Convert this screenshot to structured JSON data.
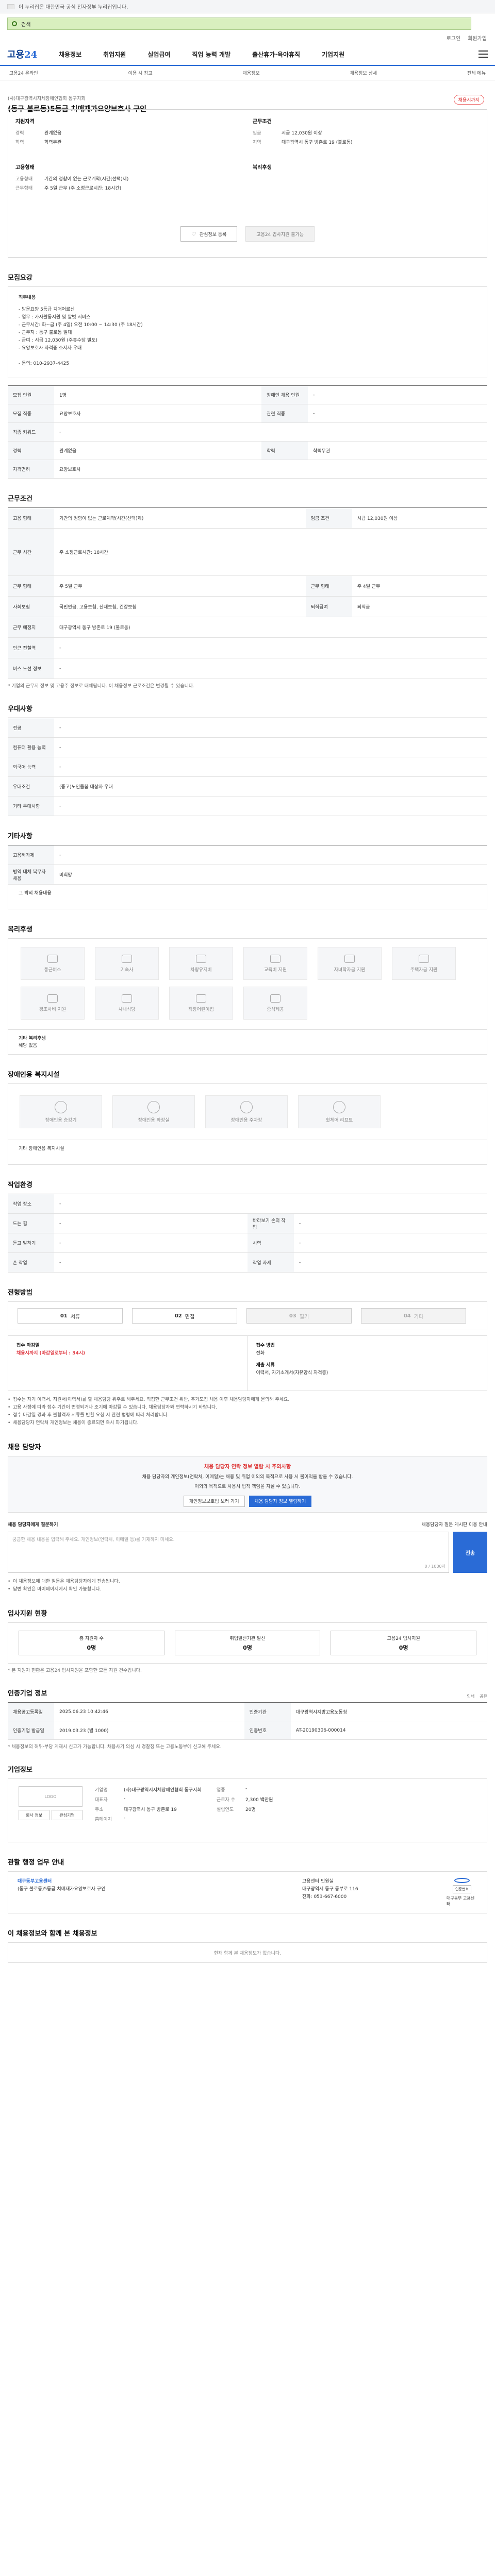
{
  "gov_banner": {
    "text": "이 누리집은 대한민국 공식 전자정부 누리집입니다."
  },
  "search": {
    "query": "검색"
  },
  "top_links": [
    "로그인",
    "회원가입"
  ],
  "logo": {
    "main": "고용",
    "accent": "24"
  },
  "gnb": [
    "채용정보",
    "취업지원",
    "실업급여",
    "직업 능력 개발",
    "출산휴가·육아휴직",
    "기업지원"
  ],
  "sub_gnb": [
    "고용24 온라인",
    "이용 시 참고",
    "채용정보",
    "채용정보 상세",
    "전체 메뉴"
  ],
  "job": {
    "company_line": "(사)대구광역시지체장애인협회 동구지회",
    "title": "(동구 불로동)5등급 치매재가요양보호사 구인",
    "badge": "채용시까지"
  },
  "summary": {
    "qual_title": "지원자격",
    "qual": [
      {
        "k": "경력",
        "v": "관계없음"
      },
      {
        "k": "학력",
        "v": "학력무관"
      }
    ],
    "cond_title": "근무조건",
    "cond": [
      {
        "k": "임금",
        "v": "시급 12,030원 이상"
      },
      {
        "k": "지역",
        "v": "대구광역시 동구 방촌로 19 (불로동)"
      }
    ],
    "type_title": "고용형태",
    "type": [
      {
        "k": "고용형태",
        "v": "기간의 정함이 없는 근로계약(시간(선택)제)"
      },
      {
        "k": "근무형태",
        "v": "주 5일 근무 (주 소정근로시간: 18시간)"
      }
    ],
    "welfare_title": "복리후생",
    "btn_scrap": "관심정보 등록",
    "btn_apply": "고용24 입사지원 불가능"
  },
  "sections": {
    "recruit": "모집요강",
    "work": "근무조건",
    "pref": "우대사항",
    "etc": "기타사항",
    "welfare": "복리후생",
    "disab": "장애인용 복지시설",
    "env": "작업환경",
    "process": "전형방법",
    "contact": "채용 담당자",
    "stats": "입사지원 현황",
    "info": "인증기업 정보",
    "company": "기업정보",
    "agency": "관할 행정 업무 안내",
    "recommend": "이 채용정보와 함께 본 채용정보"
  },
  "job_desc": {
    "title": "직무내용",
    "lines": [
      "- 방문요양 5등급 치매어르신",
      "- 업무 : 가사활동지원 및 말벗 서비스",
      "- 근무시간: 화~금 (주 4일) 오전 10:00 ~ 14:30 (주 18시간)",
      "- 근무지 : 동구 불로동 일대",
      "- 급여 : 시급 12,030원 (주휴수당 별도)",
      "- 요양보호사 자격증 소지자 우대",
      "",
      "- 문의: 010-2937-4425"
    ]
  },
  "recruit_table": [
    {
      "k1": "모집 인원",
      "v1": "1명",
      "k2": "장애인 채용 인원",
      "v2": "-"
    },
    {
      "k1": "모집 직종",
      "v1": "요양보호사",
      "k2": "관련 직종",
      "v2": "-"
    },
    {
      "k1": "직종 키워드",
      "v1": "-",
      "k2": "",
      "v2": ""
    },
    {
      "k1": "경력",
      "v1": "관계없음",
      "k2": "학력",
      "v2": "학력무관"
    },
    {
      "k1": "자격면허",
      "v1": "요양보호사",
      "k2": "",
      "v2": ""
    }
  ],
  "work_table": [
    {
      "k1": "고용 형태",
      "v1": "기간의 정함이 없는 근로계약(시간(선택)제)",
      "k2": "임금 조건",
      "v2": "시급 12,030원 이상"
    },
    {
      "k1": "근무 시간",
      "v1": "주 소정근로시간: 18시간",
      "k2": "",
      "v2": ""
    },
    {
      "k1": "근무 형태",
      "v1": "주 5일 근무",
      "k2": "근무 형태",
      "v2": "주 4일 근무"
    },
    {
      "k1": "사회보험",
      "v1": "국민연금, 고용보험, 산재보험, 건강보험",
      "k2": "퇴직급여",
      "v2": "퇴직금"
    },
    {
      "k1": "근무 예정지",
      "v1": "대구광역시 동구 방촌로 19 (불로동)",
      "k2": "",
      "v2": ""
    },
    {
      "k1": "인근 전철역",
      "v1": "-",
      "k2": "",
      "v2": ""
    },
    {
      "k1": "버스 노선 정보",
      "v1": "-",
      "k2": "",
      "v2": ""
    }
  ],
  "work_note": "* 기업의 근무지 정보 및 고용주 정보로 대체됩니다. 이 채용정보 근로조건은 변경될 수 있습니다.",
  "pref_table": [
    {
      "k": "전공",
      "v": "-"
    },
    {
      "k": "컴퓨터 활용 능력",
      "v": "-"
    },
    {
      "k": "외국어 능력",
      "v": "-"
    },
    {
      "k": "우대조건",
      "v": "(중고)노인돌봄 대상자 우대"
    },
    {
      "k": "기타 우대사항",
      "v": "-"
    }
  ],
  "etc_table": [
    {
      "k": "고용허가제",
      "v": "-"
    },
    {
      "k": "병역 대체 복무자 채용",
      "v": "비희망"
    }
  ],
  "etc_free": "그 밖의 채용내용",
  "welfare_items": [
    "통근버스",
    "기숙사",
    "차량유지비",
    "교육비 지원",
    "자녀학자금 지원",
    "주택자금 지원",
    "경조사비 지원",
    "사내식당",
    "직장어린이집",
    "중식제공"
  ],
  "welfare_free_label": "기타 복리후생",
  "welfare_free_value": "해당 없음",
  "disab_items": [
    "장애인용 승강기",
    "장애인용 화장실",
    "장애인용 주차장",
    "휠체어 리프트",
    "경사로"
  ],
  "disab_free": "기타 장애인용 복지시설",
  "env_table": [
    {
      "k1": "작업 장소",
      "v1": "-",
      "k2": "",
      "v2": ""
    },
    {
      "k1": "드는 힘",
      "v1": "-",
      "k2": "바라보기 손의 작업",
      "v2": "-"
    },
    {
      "k1": "듣고 말하기",
      "v1": "-",
      "k2": "시력",
      "v2": "-"
    },
    {
      "k1": "손 작업",
      "v1": "-",
      "k2": "작업 자세",
      "v2": "-"
    }
  ],
  "process_steps": [
    {
      "n": "01",
      "label": "서류",
      "on": true
    },
    {
      "n": "02",
      "label": "면접",
      "on": true
    },
    {
      "n": "03",
      "label": "필기",
      "on": false
    },
    {
      "n": "04",
      "label": "기타",
      "on": false
    }
  ],
  "apply": {
    "period_label": "접수 마감일",
    "period_value": "채용시까지 (마감일로부터 : 34시)",
    "method_label": "접수 방법",
    "method_value": "전화",
    "docs_label": "제출 서류",
    "docs_value": "이력서, 자기소개서(자유양식 자격증)"
  },
  "apply_bullets": [
    "접수는 자기 이력서, 지원서(이력서)를 할 채용담당 위주로 해주세요. 직접한 근무조건 위반, 추가모집 채용 이후 채용담당자에게 문의해 주세요.",
    "고용 사정에 따라 접수 기간이 변경되거나 조기에 마감될 수 있습니다. 채용담당자와 연락하시기 바랍니다.",
    "접수 마감일 경과 후 불합격자 서류를 반환 요청 시 관련 법령에 따라 처리합니다.",
    "채용담당자 연락처 개인정보는 채용이 종료되면 즉시 파기됩니다."
  ],
  "contact": {
    "warn": "채용 담당자 연락 정보 열람 시 주의사항",
    "line1": "채용 담당자의 개인정보(연락처, 이메일)는 채용 및 취업 이외의 목적으로 사용 시 불이익을 받을 수 있습니다.",
    "line2": "이외의 목적으로 사용시 법적 책임을 지실 수 있습니다.",
    "btn1": "개인정보보호법 보러 가기",
    "btn2": "채용 담당자 정보 열람하기"
  },
  "question": {
    "title": "채용 담당자에게 질문하기",
    "guide": "채용담당자 질문 게시판 이용 안내",
    "placeholder": "궁금한 채용 내용을 입력해 주세요. 개인정보(연락처, 이메일 등)를 기재하지 마세요.",
    "count": "0 / 1000자",
    "btn": "전송",
    "notes": [
      "이 채용정보에 대한 질문은 채용담당자에게 전송됩니다.",
      "답변 확인은 마이페이지에서 확인 가능합니다."
    ]
  },
  "stats": [
    {
      "label": "총 지원자 수",
      "value": "0명"
    },
    {
      "label": "취업알선기관 알선",
      "value": "0명"
    },
    {
      "label": "고용24 입사지원",
      "value": "0명"
    }
  ],
  "stats_note": "* 본 지원자 현황은 고용24 입사지원을 포함한 모든 지원 건수입니다.",
  "info_tools": [
    "인쇄",
    "공유"
  ],
  "info_table": [
    {
      "k1": "채용공고등록일",
      "v1": "2025.06.23 10:42:46",
      "k2": "인증기관",
      "v2": "대구광역시지방고용노동청"
    },
    {
      "k1": "인증기업 발급일",
      "v1": "2019.03.23 (별 1000)",
      "k2": "인증번호",
      "v2": "AT-20190306-000014"
    }
  ],
  "info_note": "* 채용정보의 허위·부당 게재시 신고가 가능합니다. 채용사기 의심 시 경찰청 또는 고용노동부에 신고해 주세요.",
  "company": {
    "logo_text": "LOGO",
    "btn1": "회사 정보",
    "btn2": "관심기업",
    "rows": [
      {
        "k1": "기업명",
        "v1": "(사)대구광역시지체장애인협회 동구지회",
        "k2": "업종",
        "v2": "-"
      },
      {
        "k1": "대표자",
        "v1": "-",
        "k2": "근로자 수",
        "v2": "2,300 백만원"
      },
      {
        "k1": "주소",
        "v1": "대구광역시 동구 방촌로 19",
        "k2": "설립연도",
        "v2": "20명"
      },
      {
        "k1": "홈페이지",
        "v1": "-",
        "k2": "",
        "v2": ""
      }
    ]
  },
  "agency": {
    "name": "대구동부고용센터",
    "job_line": "(동구 불로동)5등급 치매재가요양보호사 구인",
    "mid": [
      "고용센터 민원실",
      "대구광역시 동구 동부로 116",
      "전화: 053-667-6000"
    ],
    "right_tag": "인증번호",
    "sub": "대구동부 고용센터"
  },
  "recommend_text": "현재 함께 본 채용정보가 없습니다."
}
